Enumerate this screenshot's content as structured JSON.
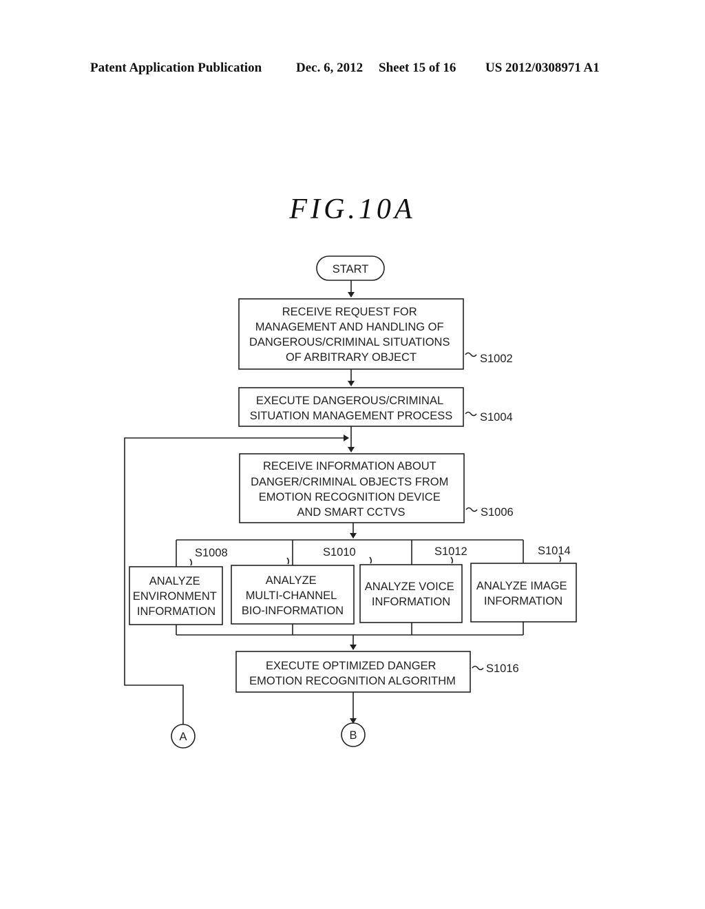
{
  "header": {
    "publication": "Patent Application Publication",
    "date": "Dec. 6, 2012",
    "sheet": "Sheet 15 of 16",
    "number": "US 2012/0308971 A1"
  },
  "figure": {
    "title": "FIG.10A"
  },
  "flowchart": {
    "start": "START",
    "steps": {
      "s1002": {
        "id": "S1002",
        "lines": [
          "RECEIVE REQUEST FOR",
          "MANAGEMENT AND HANDLING OF",
          "DANGEROUS/CRIMINAL SITUATIONS",
          "OF ARBITRARY OBJECT"
        ]
      },
      "s1004": {
        "id": "S1004",
        "lines": [
          "EXECUTE DANGEROUS/CRIMINAL",
          "SITUATION MANAGEMENT PROCESS"
        ]
      },
      "s1006": {
        "id": "S1006",
        "lines": [
          "RECEIVE INFORMATION ABOUT",
          "DANGER/CRIMINAL OBJECTS FROM",
          "EMOTION RECOGNITION DEVICE",
          "AND SMART CCTVS"
        ]
      },
      "s1008": {
        "id": "S1008",
        "lines": [
          "ANALYZE",
          "ENVIRONMENT",
          "INFORMATION"
        ]
      },
      "s1010": {
        "id": "S1010",
        "lines": [
          "ANALYZE",
          "MULTI-CHANNEL",
          "BIO-INFORMATION"
        ]
      },
      "s1012": {
        "id": "S1012",
        "lines": [
          "ANALYZE VOICE",
          "INFORMATION"
        ]
      },
      "s1014": {
        "id": "S1014",
        "lines": [
          "ANALYZE IMAGE",
          "INFORMATION"
        ]
      },
      "s1016": {
        "id": "S1016",
        "lines": [
          "EXECUTE OPTIMIZED DANGER",
          "EMOTION RECOGNITION ALGORITHM"
        ]
      }
    },
    "connectors": {
      "a": "A",
      "b": "B"
    }
  }
}
